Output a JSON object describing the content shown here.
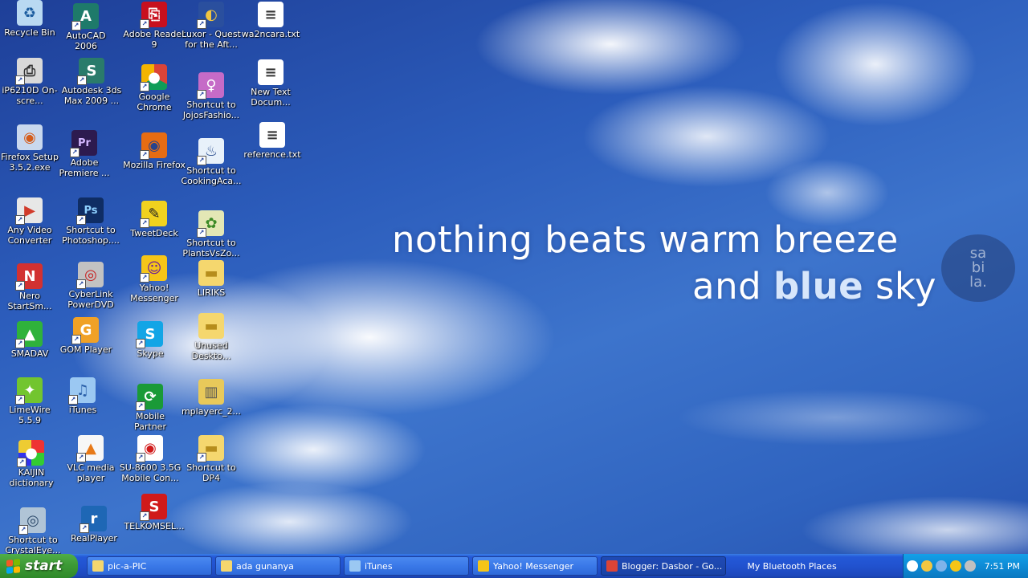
{
  "wallpaper": {
    "line1": "nothing beats warm breeze",
    "line2_prefix": "and ",
    "line2_bold": "blue",
    "line2_suffix": " sky",
    "watermark": [
      "sa",
      "bi",
      "la."
    ]
  },
  "desktop_icons": [
    {
      "label": "Recycle Bin",
      "icon": "recycle-bin-icon"
    },
    {
      "label": "AutoCAD 2006",
      "icon": "autocad-icon"
    },
    {
      "label": "Adobe Reader 9",
      "icon": "adobe-reader-icon"
    },
    {
      "label": "Luxor - Quest for the Aft...",
      "icon": "luxor-icon"
    },
    {
      "label": "wa2ncara.txt",
      "icon": "text-file-icon"
    },
    {
      "label": "iP6210D On-scre...",
      "icon": "printer-icon"
    },
    {
      "label": "Autodesk 3ds Max 2009 ...",
      "icon": "3ds-max-icon"
    },
    {
      "label": "Google Chrome",
      "icon": "chrome-icon"
    },
    {
      "label": "Shortcut to JojosFashio...",
      "icon": "jojos-fashion-icon"
    },
    {
      "label": "New Text Docum...",
      "icon": "text-file-icon"
    },
    {
      "label": "Firefox Setup 3.5.2.exe",
      "icon": "firefox-setup-icon"
    },
    {
      "label": "Adobe Premiere ...",
      "icon": "premiere-icon"
    },
    {
      "label": "Mozilla Firefox",
      "icon": "firefox-icon"
    },
    {
      "label": "Shortcut to CookingAca...",
      "icon": "cooking-academy-icon"
    },
    {
      "label": "reference.txt",
      "icon": "text-file-icon"
    },
    {
      "label": "Any Video Converter",
      "icon": "video-converter-icon"
    },
    {
      "label": "Shortcut to Photoshop....",
      "icon": "photoshop-icon"
    },
    {
      "label": "TweetDeck",
      "icon": "tweetdeck-icon"
    },
    {
      "label": "Shortcut to PlantsVsZo...",
      "icon": "plants-vs-zombies-icon"
    },
    {
      "label": "CyberLink PowerDVD",
      "icon": "powerdvd-icon"
    },
    {
      "label": "Yahoo! Messenger",
      "icon": "yahoo-messenger-icon"
    },
    {
      "label": "LIRIKS",
      "icon": "folder-icon"
    },
    {
      "label": "Nero StartSm...",
      "icon": "nero-icon"
    },
    {
      "label": "SMADAV",
      "icon": "smadav-icon"
    },
    {
      "label": "GOM Player",
      "icon": "gom-player-icon"
    },
    {
      "label": "Skype",
      "icon": "skype-icon"
    },
    {
      "label": "Unused Deskto...",
      "icon": "folder-icon"
    },
    {
      "label": "LimeWire 5.5.9",
      "icon": "limewire-icon"
    },
    {
      "label": "iTunes",
      "icon": "itunes-icon"
    },
    {
      "label": "Mobile Partner",
      "icon": "mobile-partner-icon"
    },
    {
      "label": "mplayerc_2...",
      "icon": "zip-file-icon"
    },
    {
      "label": "KAIJIN dictionary",
      "icon": "kaijin-icon"
    },
    {
      "label": "VLC media player",
      "icon": "vlc-icon"
    },
    {
      "label": "SU-8600 3.5G Mobile Con...",
      "icon": "su-8600-icon"
    },
    {
      "label": "Shortcut to DP4",
      "icon": "folder-icon"
    },
    {
      "label": "Shortcut to CrystalEye...",
      "icon": "crystaleye-icon"
    },
    {
      "label": "RealPlayer",
      "icon": "realplayer-icon"
    },
    {
      "label": "TELKOMSEL...",
      "icon": "telkomsel-icon"
    }
  ],
  "taskbar": {
    "start_label": "start",
    "tasks": [
      {
        "label": "pic-a-PIC",
        "icon": "folder-icon"
      },
      {
        "label": "ada gunanya",
        "icon": "folder-icon"
      },
      {
        "label": "iTunes",
        "icon": "itunes-icon"
      },
      {
        "label": "Yahoo! Messenger",
        "icon": "yahoo-messenger-icon"
      },
      {
        "label": "Blogger: Dasbor - Go...",
        "icon": "chrome-icon"
      },
      {
        "label": "My Bluetooth Places",
        "icon": ""
      }
    ],
    "tray_icons": [
      "collapse-tray-icon",
      "shield-icon",
      "network-icon",
      "yahoo-tray-icon",
      "gear-icon"
    ],
    "clock": "7:51 PM"
  },
  "colors": {
    "taskbar_blue": "#2152cf",
    "start_green": "#3d9a36",
    "tray_blue": "#0e8bd6"
  }
}
